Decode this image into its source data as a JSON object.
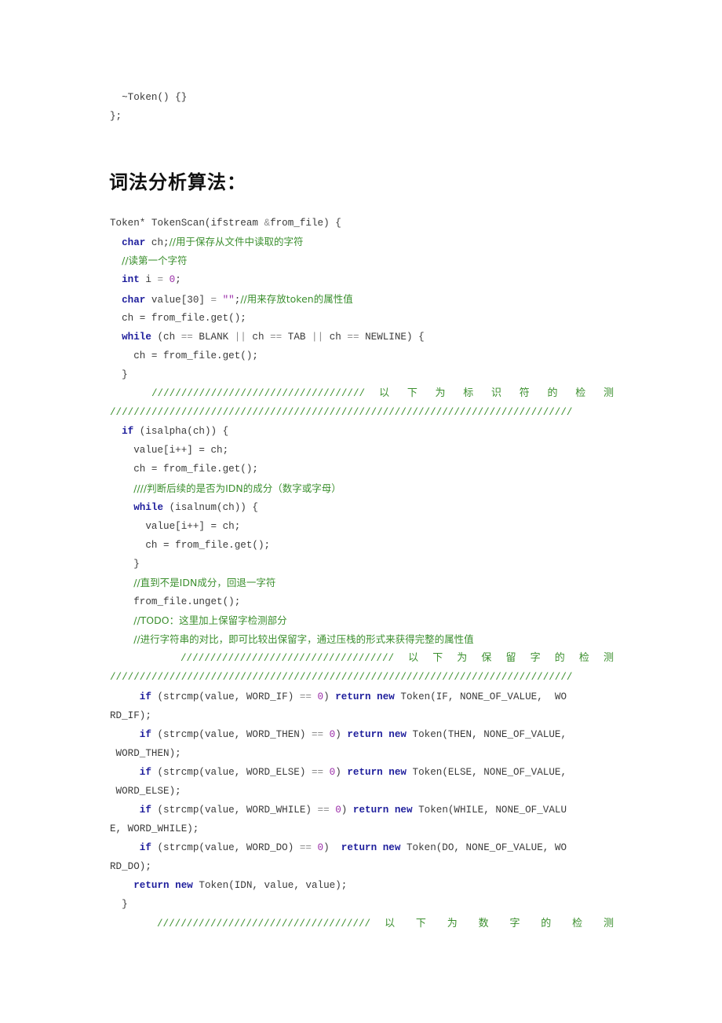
{
  "document": {
    "pre_lines": [
      "  ~Token() {}",
      "};"
    ],
    "section_heading": "词法分析算法：",
    "code": {
      "l01": {
        "a": "Token* TokenScan(ifstream ",
        "b": "&",
        "c": "from_file) {"
      },
      "l02": {
        "kw": "char",
        "code": " ch;",
        "comment": "//用于保存从文件中读取的字符"
      },
      "l03": {
        "comment": "//读第一个字符"
      },
      "l04": {
        "kw": "int",
        "a": " i ",
        "op": "=",
        "b": " ",
        "num": "0",
        "c": ";"
      },
      "l05": {
        "kw": "char",
        "a": " value[30] ",
        "op": "=",
        "b": " ",
        "str": "\"\"",
        "c": ";",
        "comment": "//用来存放token的属性值"
      },
      "l06": {
        "a": "ch = from_file.get();"
      },
      "l07": {
        "kw": "while",
        "a": " (ch ",
        "op1": "==",
        "b": " BLANK ",
        "op2": "||",
        "c": " ch ",
        "op3": "==",
        "d": " TAB ",
        "op4": "||",
        "e": " ch ",
        "op5": "==",
        "f": " NEWLINE) {"
      },
      "l08": {
        "a": "ch = from_file.get();"
      },
      "l09": {
        "a": "}"
      },
      "sep1": {
        "slashes": "////////////////////////////////////",
        "chars": [
          "以",
          "下",
          "为",
          "标",
          "识",
          "符",
          "的",
          "检",
          "测"
        ]
      },
      "sep1b": {
        "slashes": "//////////////////////////////////////////////////////////////////////////////"
      },
      "l10": {
        "kw": "if",
        "a": " (isalpha(ch)) {"
      },
      "l11": {
        "a": "value[i++] = ch;"
      },
      "l12": {
        "a": "ch = from_file.get();"
      },
      "l13": {
        "comment": "////判断后续的是否为IDN的成分（数字或字母）"
      },
      "l14": {
        "kw": "while",
        "a": " (isalnum(ch)) {"
      },
      "l15": {
        "a": "value[i++] = ch;"
      },
      "l16": {
        "a": "ch = from_file.get();"
      },
      "l17": {
        "a": "}"
      },
      "l18": {
        "comment": "//直到不是IDN成分，回退一字符"
      },
      "l19": {
        "a": "from_file.unget();"
      },
      "l20": {
        "comment": "//TODO：这里加上保留字检测部分"
      },
      "l21": {
        "comment": "//进行字符串的对比，即可比较出保留字，通过压栈的形式来获得完整的属性值"
      },
      "sep2": {
        "slashes": "////////////////////////////////////",
        "chars": [
          "以",
          "下",
          "为",
          "保",
          "留",
          "字",
          "的",
          "检",
          "测"
        ]
      },
      "sep2b": {
        "slashes": "//////////////////////////////////////////////////////////////////////////////"
      },
      "l22": {
        "kw": "if",
        "a": " (strcmp(value, WORD_IF) ",
        "op": "==",
        "num": " 0",
        "b": ") ",
        "kw2": "return",
        "kw3": "new",
        "c": " Token(IF, NONE_OF_VALUE,  WO"
      },
      "l22b": {
        "a": "RD_IF);"
      },
      "l23": {
        "kw": "if",
        "a": " (strcmp(value, WORD_THEN) ",
        "op": "==",
        "num": " 0",
        "b": ") ",
        "kw2": "return",
        "kw3": "new",
        "c": " Token(THEN, NONE_OF_VALUE,"
      },
      "l23b": {
        "a": " WORD_THEN);"
      },
      "l24": {
        "kw": "if",
        "a": " (strcmp(value, WORD_ELSE) ",
        "op": "==",
        "num": " 0",
        "b": ") ",
        "kw2": "return",
        "kw3": "new",
        "c": " Token(ELSE, NONE_OF_VALUE,"
      },
      "l24b": {
        "a": " WORD_ELSE);"
      },
      "l25": {
        "kw": "if",
        "a": " (strcmp(value, WORD_WHILE) ",
        "op": "==",
        "num": " 0",
        "b": ") ",
        "kw2": "return",
        "kw3": "new",
        "c": " Token(WHILE, NONE_OF_VALU"
      },
      "l25b": {
        "a": "E, WORD_WHILE);"
      },
      "l26": {
        "kw": "if",
        "a": " (strcmp(value, WORD_DO) ",
        "op": "==",
        "num": " 0",
        "b": ")  ",
        "kw2": "return",
        "kw3": "new",
        "c": " Token(DO, NONE_OF_VALUE, WO"
      },
      "l26b": {
        "a": "RD_DO);"
      },
      "l27": {
        "kw": "return",
        "kw2": "new",
        "a": " Token(IDN, value, value);"
      },
      "l28": {
        "a": "}"
      },
      "sep3": {
        "slashes": "////////////////////////////////////",
        "chars": [
          "以",
          "下",
          "为",
          "数",
          "字",
          "的",
          "检",
          "测"
        ]
      }
    }
  },
  "colors": {
    "keyword": "#1e1e9c",
    "comment": "#3b8f2e",
    "number": "#9a2ca8",
    "text": "#3a3a3a",
    "heading": "#111111"
  }
}
